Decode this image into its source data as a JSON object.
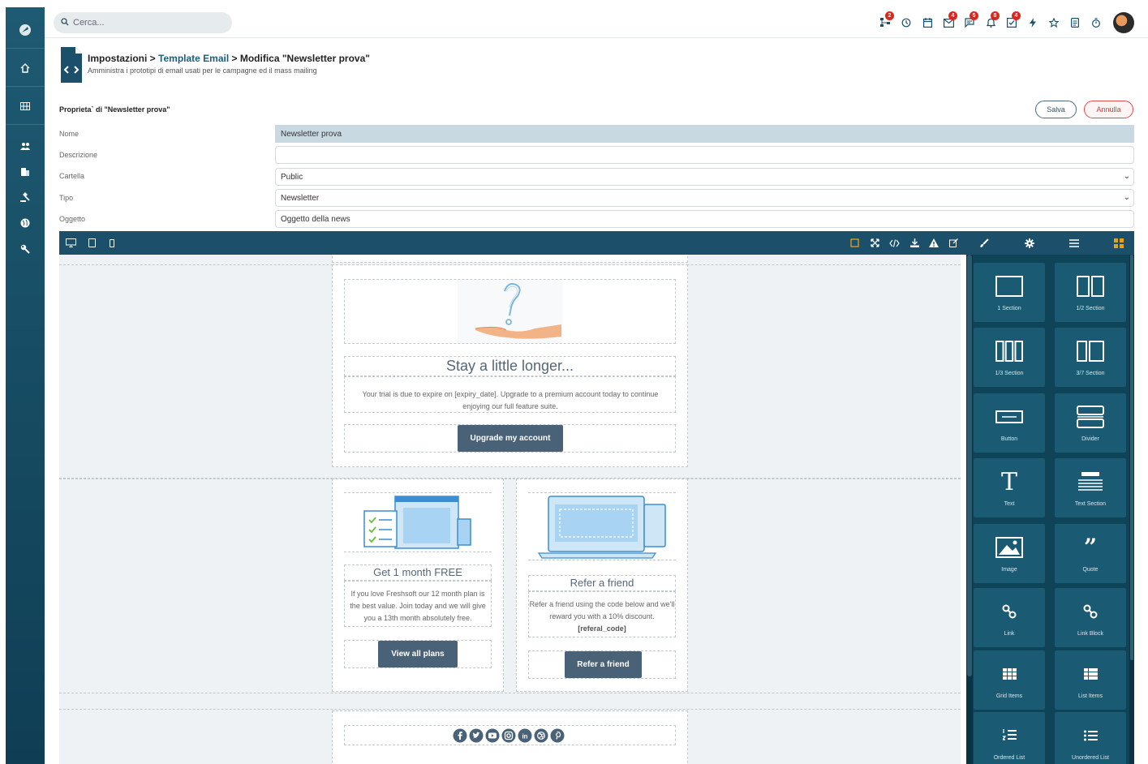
{
  "search": {
    "placeholder": "Cerca..."
  },
  "topbar_icons": [
    {
      "icon": "org-chart-icon",
      "badge": "2"
    },
    {
      "icon": "history-icon",
      "badge": ""
    },
    {
      "icon": "calendar-icon",
      "badge": ""
    },
    {
      "icon": "mail-icon",
      "badge": "4"
    },
    {
      "icon": "chat-icon",
      "badge": "5"
    },
    {
      "icon": "bell-icon",
      "badge": "8"
    },
    {
      "icon": "tasks-icon",
      "badge": "4"
    },
    {
      "icon": "lightning-icon",
      "badge": ""
    },
    {
      "icon": "star-icon",
      "badge": ""
    },
    {
      "icon": "document-icon",
      "badge": ""
    },
    {
      "icon": "timer-icon",
      "badge": ""
    }
  ],
  "header": {
    "breadcrumb_root": "Impostazioni",
    "breadcrumb_sep1": " > ",
    "breadcrumb_link": "Template Email",
    "breadcrumb_sep2": " > ",
    "breadcrumb_current": "Modifica \"Newsletter prova\"",
    "subtitle": "Amministra i prototipi di email usati per le campagne ed il mass mailing"
  },
  "properties": {
    "title": "Proprieta` di \"Newsletter prova\"",
    "save_label": "Salva",
    "cancel_label": "Annulla",
    "fields": {
      "nome_label": "Nome",
      "nome_value": "Newsletter prova",
      "descrizione_label": "Descrizione",
      "descrizione_value": "",
      "cartella_label": "Cartella",
      "cartella_value": "Public",
      "tipo_label": "Tipo",
      "tipo_value": "Newsletter",
      "oggetto_label": "Oggetto",
      "oggetto_value": "Oggetto della news"
    }
  },
  "email": {
    "hero_title": "Stay a little longer...",
    "hero_body": "Your trial is due to expire on [expiry_date]. Upgrade to a premium account today to continue enjoying our full feature suite.",
    "hero_button": "Upgrade my account",
    "col1_title": "Get 1 month FREE",
    "col1_body": "If you love Freshsoft our 12 month plan is the best value. Join today and we will give you a 13th month absolutely free.",
    "col1_button": "View all plans",
    "col2_title": "Refer a friend",
    "col2_body": "Refer a friend using the code below and we'll reward you with a 10% discount.",
    "col2_code": "[referal_code]",
    "col2_button": "Refer a friend",
    "social_icons": [
      "facebook-icon",
      "twitter-icon",
      "youtube-icon",
      "instagram-icon",
      "linkedin-icon",
      "dribbble-icon",
      "pinterest-icon"
    ]
  },
  "blocks": [
    {
      "label": "1 Section",
      "icon": "one-section-icon"
    },
    {
      "label": "1/2 Section",
      "icon": "half-section-icon"
    },
    {
      "label": "1/3 Section",
      "icon": "third-section-icon"
    },
    {
      "label": "3/7 Section",
      "icon": "three-seven-section-icon"
    },
    {
      "label": "Button",
      "icon": "button-block-icon"
    },
    {
      "label": "Divider",
      "icon": "divider-block-icon"
    },
    {
      "label": "Text",
      "icon": "text-block-icon"
    },
    {
      "label": "Text Section",
      "icon": "text-section-icon"
    },
    {
      "label": "Image",
      "icon": "image-block-icon"
    },
    {
      "label": "Quote",
      "icon": "quote-block-icon"
    },
    {
      "label": "Link",
      "icon": "link-block-icon"
    },
    {
      "label": "Link Block",
      "icon": "link-block-block-icon"
    },
    {
      "label": "Grid Items",
      "icon": "grid-items-icon"
    },
    {
      "label": "List Items",
      "icon": "list-items-icon"
    },
    {
      "label": "Ordered List",
      "icon": "ordered-list-icon"
    },
    {
      "label": "Unordered List",
      "icon": "unordered-list-icon"
    }
  ],
  "colors": {
    "sidebar": "#1e5a72",
    "toolbar": "#1b4f6a",
    "badge": "#d9281f",
    "email_button": "#4a6278",
    "active_tool": "#e8a21a"
  }
}
